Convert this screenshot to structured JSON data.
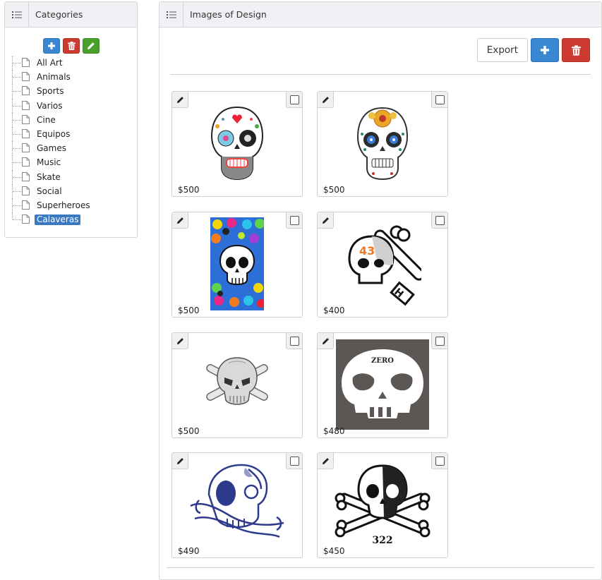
{
  "categories_panel": {
    "title": "Categories",
    "items": [
      {
        "label": "All Art",
        "selected": false
      },
      {
        "label": "Animals",
        "selected": false
      },
      {
        "label": "Sports",
        "selected": false
      },
      {
        "label": "Varios",
        "selected": false
      },
      {
        "label": "Cine",
        "selected": false
      },
      {
        "label": "Equipos",
        "selected": false
      },
      {
        "label": "Games",
        "selected": false
      },
      {
        "label": "Music",
        "selected": false
      },
      {
        "label": "Skate",
        "selected": false
      },
      {
        "label": "Social",
        "selected": false
      },
      {
        "label": "Superheroes",
        "selected": false
      },
      {
        "label": "Calaveras",
        "selected": true
      }
    ]
  },
  "images_panel": {
    "title": "Images of Design",
    "export_label": "Export",
    "cards": [
      {
        "price": "$500",
        "art": "sugar-skull-colorful"
      },
      {
        "price": "$500",
        "art": "sugar-skull-flowers"
      },
      {
        "price": "$500",
        "art": "skull-pattern-colorful"
      },
      {
        "price": "$400",
        "art": "skull-crossbones-43"
      },
      {
        "price": "$500",
        "art": "skull-crossbones-grey"
      },
      {
        "price": "$480",
        "art": "zero-skull"
      },
      {
        "price": "$490",
        "art": "blue-ornate-skull"
      },
      {
        "price": "$450",
        "art": "skull-crossbones-322"
      }
    ],
    "art_text": {
      "zero": "ZERO",
      "num43": "43",
      "num322": "322"
    }
  },
  "colors": {
    "accent_blue": "#3a87d4",
    "danger_red": "#cd3a2f",
    "success_green": "#4aa02c",
    "selected_bg": "#3a78c4"
  }
}
